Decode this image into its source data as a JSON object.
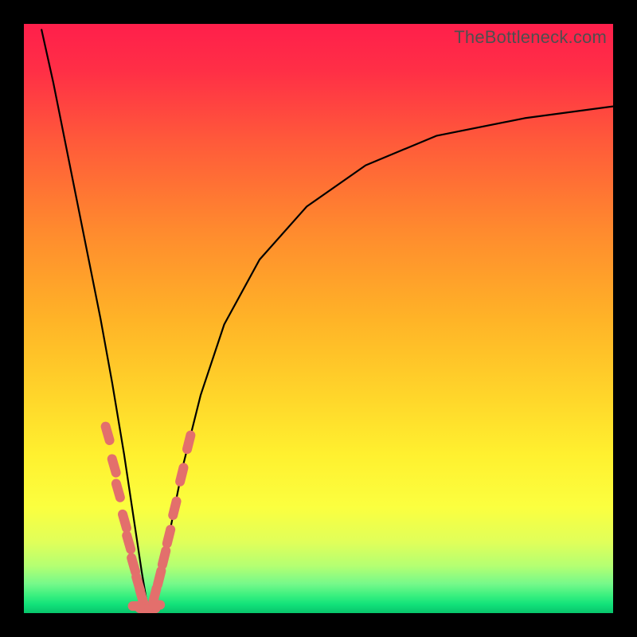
{
  "watermark": "TheBottleneck.com",
  "colors": {
    "frame": "#000000",
    "curve": "#000000",
    "marker": "#e36f6c",
    "gradient_stops": [
      "#ff1f4b",
      "#ff5a3a",
      "#ffb327",
      "#fff02f",
      "#b4ff72",
      "#12e27a"
    ]
  },
  "chart_data": {
    "type": "line",
    "title": "",
    "xlabel": "",
    "ylabel": "",
    "xlim": [
      0,
      100
    ],
    "ylim": [
      0,
      100
    ],
    "notch_x": 21,
    "series": [
      {
        "name": "bottleneck-curve",
        "x": [
          3,
          5,
          7,
          9,
          11,
          13,
          15,
          17,
          18.5,
          20,
          21,
          22,
          23.5,
          25,
          27,
          30,
          34,
          40,
          48,
          58,
          70,
          85,
          100
        ],
        "values": [
          99,
          90,
          80,
          70,
          60,
          50,
          39,
          27,
          17,
          7,
          1,
          1,
          7,
          15,
          25,
          37,
          49,
          60,
          69,
          76,
          81,
          84,
          86
        ]
      }
    ],
    "markers_left_branch": {
      "x": [
        14.2,
        15.3,
        16.0,
        17.1,
        17.8,
        18.6,
        19.4,
        20.0
      ],
      "values": [
        30.5,
        25.0,
        20.8,
        15.6,
        12.0,
        8.2,
        5.0,
        2.8
      ]
    },
    "markers_right_branch": {
      "x": [
        22.2,
        23.0,
        23.8,
        24.6,
        25.6,
        26.8,
        28.0
      ],
      "values": [
        3.0,
        6.0,
        9.4,
        13.0,
        17.8,
        23.5,
        29.0
      ]
    },
    "markers_bottom": {
      "x": [
        19.0,
        20.2,
        21.0,
        21.8,
        22.6
      ],
      "values": [
        1.2,
        0.8,
        0.6,
        0.8,
        1.4
      ]
    }
  }
}
